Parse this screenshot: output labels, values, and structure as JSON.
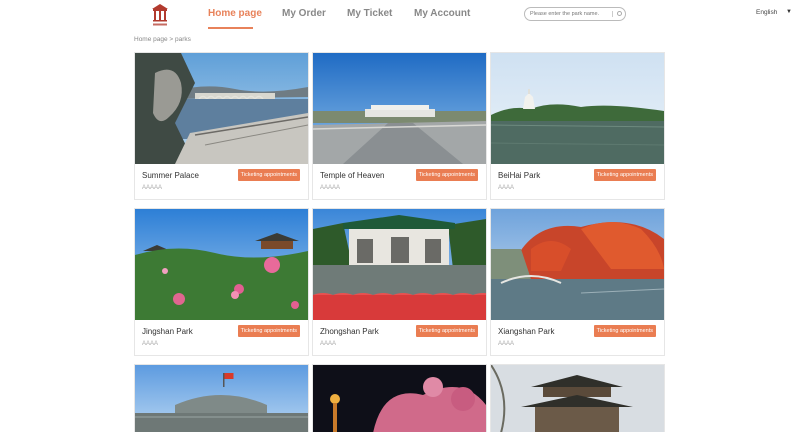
{
  "header": {
    "nav": [
      {
        "label": "Home page",
        "active": true
      },
      {
        "label": "My Order",
        "active": false
      },
      {
        "label": "My Ticket",
        "active": false
      },
      {
        "label": "My Account",
        "active": false
      }
    ],
    "search_placeholder": "Please enter the park name.",
    "language": "English"
  },
  "breadcrumb": "Home page > parks",
  "cards": [
    {
      "name": "Summer Palace",
      "badge": "Ticketing appointments",
      "level": "AAAAA"
    },
    {
      "name": "Temple of Heaven",
      "badge": "Ticketing appointments",
      "level": "AAAAA"
    },
    {
      "name": "BeiHai Park",
      "badge": "Ticketing appointments",
      "level": "AAAA"
    },
    {
      "name": "Jingshan Park",
      "badge": "Ticketing appointments",
      "level": "AAAA"
    },
    {
      "name": "Zhongshan Park",
      "badge": "Ticketing appointments",
      "level": "AAAA"
    },
    {
      "name": "Xiangshan Park",
      "badge": "Ticketing appointments",
      "level": "AAAA"
    }
  ],
  "colors": {
    "accent": "#e8825a",
    "badge": "#ea7d52"
  }
}
